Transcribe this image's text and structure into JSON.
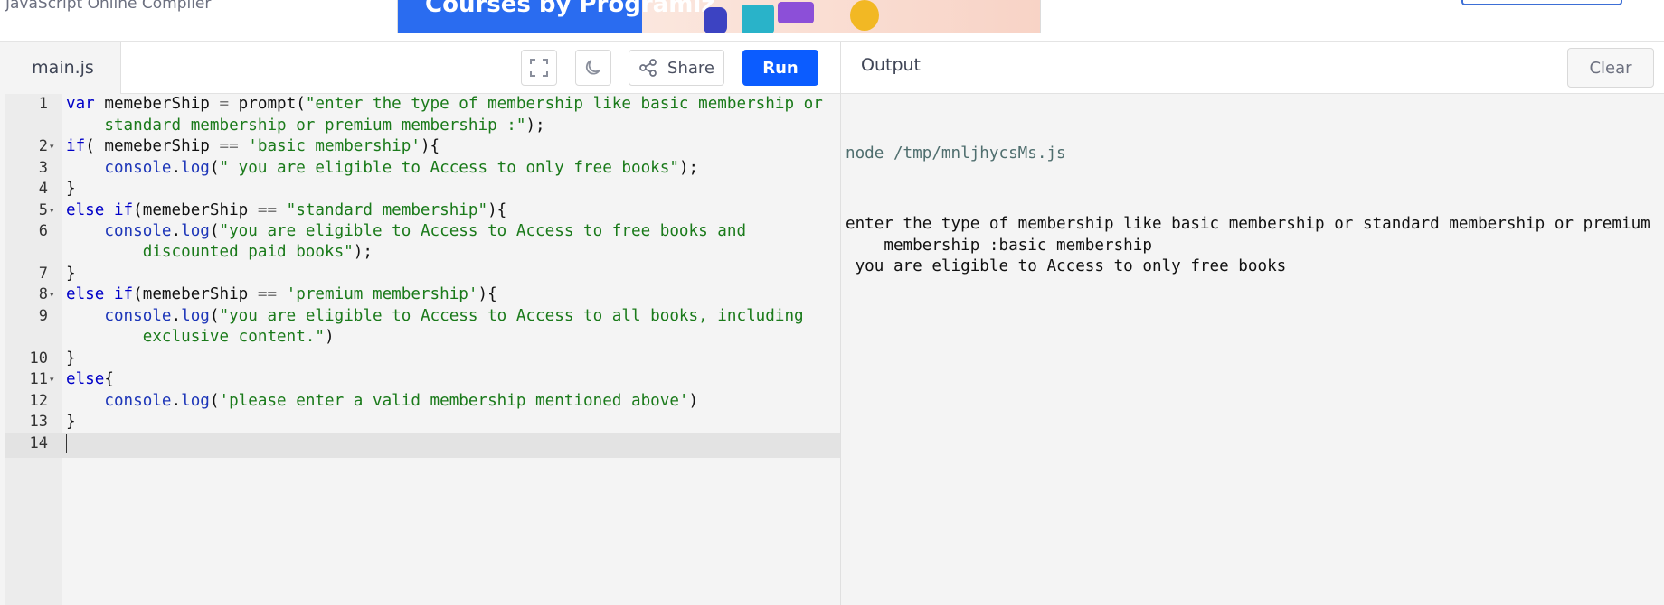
{
  "header": {
    "brand": "JavaScript Online Compiler",
    "banner_text": "Courses by Programiz"
  },
  "editor": {
    "file_tab": "main.js",
    "share_label": "Share",
    "run_label": "Run",
    "lines": [
      {
        "num": "1",
        "fold": "",
        "parts": [
          [
            "kw",
            "var"
          ],
          [
            "txt",
            " memeberShip "
          ],
          [
            "op",
            "="
          ],
          [
            "txt",
            " prompt("
          ],
          [
            "str",
            "\"enter the type of membership like basic membership or"
          ]
        ]
      },
      {
        "num": "",
        "fold": "",
        "parts": [
          [
            "str",
            "    standard membership or premium membership :\""
          ],
          [
            "txt",
            ");"
          ]
        ]
      },
      {
        "num": "2",
        "fold": "▾",
        "parts": [
          [
            "kw",
            "if"
          ],
          [
            "txt",
            "( memeberShip "
          ],
          [
            "op",
            "=="
          ],
          [
            "txt",
            " "
          ],
          [
            "str",
            "'basic membership'"
          ],
          [
            "txt",
            "){"
          ]
        ]
      },
      {
        "num": "3",
        "fold": "",
        "parts": [
          [
            "txt",
            "    "
          ],
          [
            "meth",
            "console"
          ],
          [
            "txt",
            "."
          ],
          [
            "meth",
            "log"
          ],
          [
            "txt",
            "("
          ],
          [
            "str",
            "\" you are eligible to Access to only free books\""
          ],
          [
            "txt",
            ");"
          ]
        ]
      },
      {
        "num": "4",
        "fold": "",
        "parts": [
          [
            "txt",
            "}"
          ]
        ]
      },
      {
        "num": "5",
        "fold": "▾",
        "parts": [
          [
            "kw",
            "else if"
          ],
          [
            "txt",
            "(memeberShip "
          ],
          [
            "op",
            "=="
          ],
          [
            "txt",
            " "
          ],
          [
            "str",
            "\"standard membership\""
          ],
          [
            "txt",
            "){"
          ]
        ]
      },
      {
        "num": "6",
        "fold": "",
        "parts": [
          [
            "txt",
            "    "
          ],
          [
            "meth",
            "console"
          ],
          [
            "txt",
            "."
          ],
          [
            "meth",
            "log"
          ],
          [
            "txt",
            "("
          ],
          [
            "str",
            "\"you are eligible to Access to Access to free books and"
          ]
        ]
      },
      {
        "num": "",
        "fold": "",
        "parts": [
          [
            "str",
            "        discounted paid books\""
          ],
          [
            "txt",
            ");"
          ]
        ]
      },
      {
        "num": "7",
        "fold": "",
        "parts": [
          [
            "txt",
            "}"
          ]
        ]
      },
      {
        "num": "8",
        "fold": "▾",
        "parts": [
          [
            "kw",
            "else if"
          ],
          [
            "txt",
            "(memeberShip "
          ],
          [
            "op",
            "=="
          ],
          [
            "txt",
            " "
          ],
          [
            "str",
            "'premium membership'"
          ],
          [
            "txt",
            "){"
          ]
        ]
      },
      {
        "num": "9",
        "fold": "",
        "parts": [
          [
            "txt",
            "    "
          ],
          [
            "meth",
            "console"
          ],
          [
            "txt",
            "."
          ],
          [
            "meth",
            "log"
          ],
          [
            "txt",
            "("
          ],
          [
            "str",
            "\"you are eligible to Access to Access to all books, including"
          ]
        ]
      },
      {
        "num": "",
        "fold": "",
        "parts": [
          [
            "str",
            "        exclusive content.\""
          ],
          [
            "txt",
            ")"
          ]
        ]
      },
      {
        "num": "10",
        "fold": "",
        "parts": [
          [
            "txt",
            "}"
          ]
        ]
      },
      {
        "num": "11",
        "fold": "▾",
        "parts": [
          [
            "kw",
            "else"
          ],
          [
            "txt",
            "{"
          ]
        ]
      },
      {
        "num": "12",
        "fold": "",
        "parts": [
          [
            "txt",
            "    "
          ],
          [
            "meth",
            "console"
          ],
          [
            "txt",
            "."
          ],
          [
            "meth",
            "log"
          ],
          [
            "txt",
            "("
          ],
          [
            "str",
            "'please enter a valid membership mentioned above'"
          ],
          [
            "txt",
            ")"
          ]
        ]
      },
      {
        "num": "13",
        "fold": "",
        "parts": [
          [
            "txt",
            "}"
          ]
        ]
      },
      {
        "num": "14",
        "fold": "",
        "parts": []
      }
    ],
    "active_line_index": 16
  },
  "output": {
    "title": "Output",
    "clear_label": "Clear",
    "command": "node /tmp/mnljhycsMs.js",
    "lines": [
      "enter the type of membership like basic membership or standard membership or premium",
      "    membership :basic membership",
      " you are eligible to Access to only free books"
    ]
  },
  "colors": {
    "run_button": "#0b5cff",
    "keyword": "#0000c8",
    "string": "#1a7a1a"
  }
}
